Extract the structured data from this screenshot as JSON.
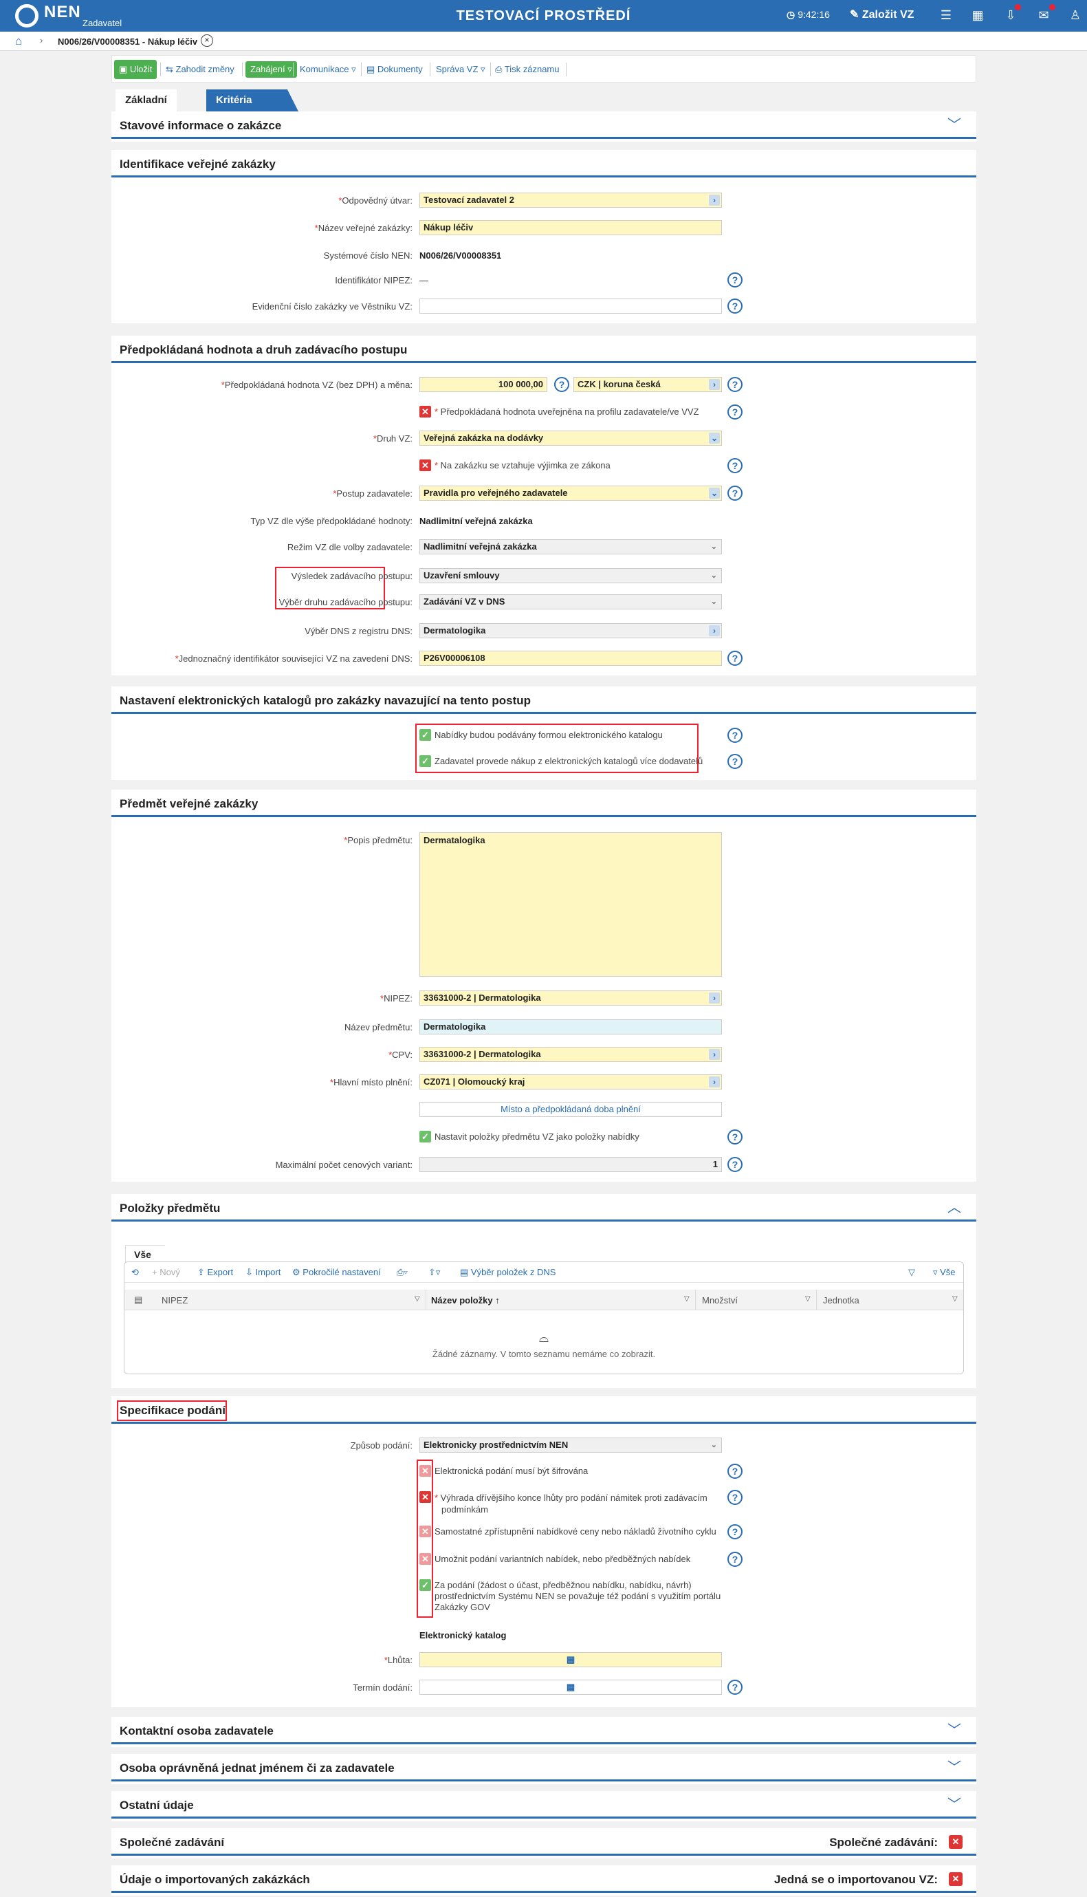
{
  "app": {
    "logo": "NEN",
    "logo_sub": "Zadavatel",
    "env": "TESTOVACÍ PROSTŘEDÍ",
    "time": "9:42:16",
    "create": "Založit VZ"
  },
  "breadcrumb": "N006/26/V00008351 - Nákup léčiv",
  "toolbar": {
    "save": "Uložit",
    "discard": "Zahodit změny",
    "start": "Zahájení ▿",
    "comm": "Komunikace ▿",
    "docs": "Dokumenty",
    "manage": "Správa VZ ▿",
    "print": "Tisk záznamu"
  },
  "tabs": [
    "Základní údaje",
    "Kritéria hodnocení"
  ],
  "stav": {
    "title": "Stavové informace o zakázce"
  },
  "ident": {
    "title": "Identifikace veřejné zakázky",
    "l_utvar": "Odpovědný útvar:",
    "v_utvar": "Testovací zadavatel 2",
    "l_nazev": "Název veřejné zakázky:",
    "v_nazev": "Nákup léčiv",
    "l_syscislo": "Systémové číslo NEN:",
    "v_syscislo": "N006/26/V00008351",
    "l_nipez": "Identifikátor NIPEZ:",
    "v_nipez": "—",
    "l_evid": "Evidenční číslo zakázky ve Věstníku VZ:"
  },
  "hodnota": {
    "title": "Předpokládaná hodnota a druh zadávacího postupu",
    "l_hodnota": "Předpokládaná hodnota VZ (bez DPH) a měna:",
    "v_hodnota": "100 000,00",
    "v_mena": "CZK | koruna česká",
    "c_uverejnena": "Předpokládaná hodnota uveřejněna na profilu zadavatele/ve VVZ",
    "l_druh": "Druh VZ:",
    "v_druh": "Veřejná zakázka na dodávky",
    "c_vyjimka": "Na zakázku se vztahuje výjimka ze zákona",
    "l_postup": "Postup zadavatele:",
    "v_postup": "Pravidla pro veřejného zadavatele",
    "l_typ": "Typ VZ dle výše předpokládané hodnoty:",
    "v_typ": "Nadlimitní veřejná zakázka",
    "l_rezim": "Režim VZ dle volby zadavatele:",
    "v_rezim": "Nadlimitní veřejná zakázka",
    "l_vysledek": "Výsledek zadávacího postupu:",
    "v_vysledek": "Uzavření smlouvy",
    "l_vyber": "Výběr druhu zadávacího postupu:",
    "v_vyber": "Zadávání VZ v DNS",
    "l_dns": "Výběr DNS z registru DNS:",
    "v_dns": "Dermatologika",
    "l_jedn": "Jednoznačný identifikátor související VZ na zavedení DNS:",
    "v_jedn": "P26V00006108"
  },
  "katalog": {
    "title": "Nastavení elektronických katalogů pro zakázky navazující na tento postup",
    "c1": "Nabídky budou podávány formou elektronického katalogu",
    "c2": "Zadavatel provede nákup z elektronických katalogů více dodavatelů"
  },
  "predmet": {
    "title": "Předmět veřejné zakázky",
    "l_popis": "Popis předmětu:",
    "v_popis": "Dermatalogika",
    "l_nipez": "NIPEZ:",
    "v_nipez": "33631000-2 | Dermatologika",
    "l_nazev": "Název předmětu:",
    "v_nazev": "Dermatologika",
    "l_cpv": "CPV:",
    "v_cpv": "33631000-2 | Dermatologika",
    "l_misto": "Hlavní místo plnění:",
    "v_misto": "CZ071 | Olomoucký kraj",
    "btn_misto": "Místo a předpokládaná doba plnění",
    "c_polozky": "Nastavit položky předmětu VZ jako položky nabídky",
    "l_max": "Maximální počet cenových variant:",
    "v_max": "1"
  },
  "polozky": {
    "title": "Položky předmětu",
    "tab": "Vše",
    "tb_new": "+ Nový",
    "tb_export": "Export",
    "tb_import": "Import",
    "tb_adv": "Pokročilé nastavení",
    "tb_print": "▿",
    "tb_share": "▿",
    "tb_dns": "Výběr položek z DNS",
    "tb_all": "Vše",
    "cols": [
      "NIPEZ",
      "Název položky",
      "Množství",
      "Jednotka"
    ],
    "empty": "Žádné záznamy. V tomto seznamu nemáme co zobrazit."
  },
  "podani": {
    "title": "Specifikace podání",
    "l_zpusob": "Způsob podání:",
    "v_zpusob": "Elektronicky prostřednictvím NEN",
    "c1": "Elektronická podání musí být šifrována",
    "c2a": "Výhrada dřívějšího konce lhůty pro podání námitek proti zadávacím",
    "c2b": "podmínkám",
    "c3": "Samostatné zpřístupnění nabídkové ceny nebo nákladů životního cyklu",
    "c4": "Umožnit podání variantních nabídek, nebo předběžných nabídek",
    "c5a": "Za podání (žádost o účast, předběžnou nabídku, nabídku, návrh)",
    "c5b": "prostřednictvím Systému NEN se považuje též podání s využitím portálu",
    "c5c": "Zakázky GOV",
    "katalog": "Elektronický katalog",
    "l_lhuta": "Lhůta:",
    "l_termin": "Termín dodání:"
  },
  "collapsed": {
    "kontakt": "Kontaktní osoba zadavatele",
    "osoba": "Osoba oprávněná jednat jménem či za zadavatele",
    "ostatni": "Ostatní údaje",
    "spolecne": "Společné zadávání",
    "spolecne_r": "Společné zadávání:",
    "import": "Údaje o importovaných zakázkách",
    "import_r": "Jedná se o importovanou VZ:"
  }
}
